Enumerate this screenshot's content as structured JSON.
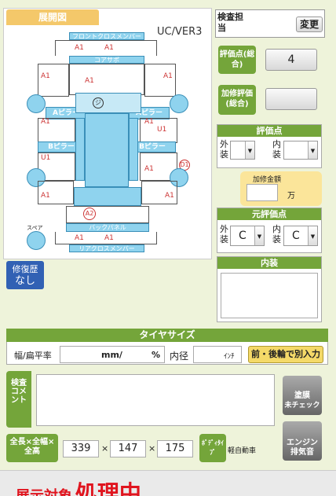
{
  "diagram": {
    "title": "展開図",
    "version": "UC/VER3",
    "parts": {
      "front_cross_member": "フロントクロスメンバー",
      "core_support": "コアサポ",
      "a_pillar": "Aピラー",
      "b_pillar": "Bピラー",
      "back_panel": "バックパネル",
      "rear_cross_member": "リアクロスメンバー",
      "spare": "スペア"
    },
    "marks": {
      "a1": "A1",
      "u1": "U1",
      "a2": "A2",
      "d1": "D1",
      "ji": "ジ"
    }
  },
  "inspector": {
    "label": "検査担当",
    "change_button": "変更"
  },
  "rating": {
    "label": "評価点(総合)",
    "value": "4"
  },
  "repair_rating": {
    "label": "加修評価(総合)",
    "value": ""
  },
  "score_section": {
    "head": "評価点",
    "exterior_label": "外装",
    "interior_label": "内装",
    "exterior_value": "",
    "interior_value": ""
  },
  "repair_amount": {
    "label": "加修金額",
    "value": "",
    "unit": "万"
  },
  "original_score": {
    "head": "元評価点",
    "exterior_label": "外装",
    "interior_label": "内装",
    "exterior_value": "C",
    "interior_value": "C"
  },
  "interior_section": {
    "head": "内装"
  },
  "repair_history": {
    "line1": "修復歴",
    "line2": "なし"
  },
  "tire": {
    "head": "タイヤサイズ",
    "width_label": "幅/扁平率",
    "mm_unit": "mm/",
    "pct_unit": "%",
    "inner_label": "内径",
    "inch_unit": "ｲﾝﾁ",
    "front_rear_button": "前・後輪で別入力"
  },
  "comment": {
    "label": "検査コメント"
  },
  "dimensions": {
    "label": "全長×全幅×全高",
    "length": "339",
    "width": "147",
    "height": "175",
    "sep": "×"
  },
  "body_type": {
    "label": "ﾎﾞﾃﾞｨﾀｲﾌﾟ",
    "value": "軽自動車"
  },
  "paint_button": {
    "line1": "塗膜",
    "line2": "未チェック"
  },
  "engine_button": {
    "line1": "エンジン",
    "line2": "排気音"
  },
  "status": {
    "prefix": "展示対象",
    "main": "処理中"
  }
}
